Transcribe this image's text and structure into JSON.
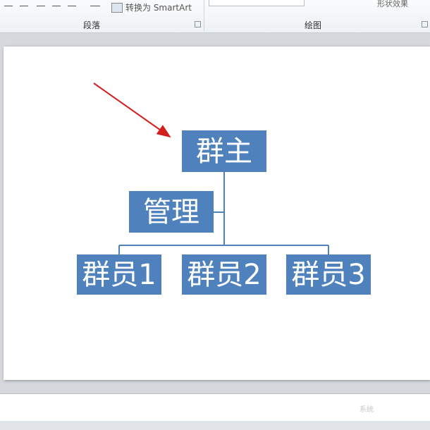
{
  "ribbon": {
    "smartart_label": "转换为 SmartArt",
    "paragraph_group": "段落",
    "drawing_group": "绘图",
    "shape_effects": "形状效果"
  },
  "chart": {
    "root": "群主",
    "assistant": "管理",
    "members": [
      "群员1",
      "群员2",
      "群员3"
    ],
    "box_color": "#4f81bd",
    "line_color": "#4f81bd",
    "arrow_color": "#d31f1f"
  },
  "watermark": "系统"
}
